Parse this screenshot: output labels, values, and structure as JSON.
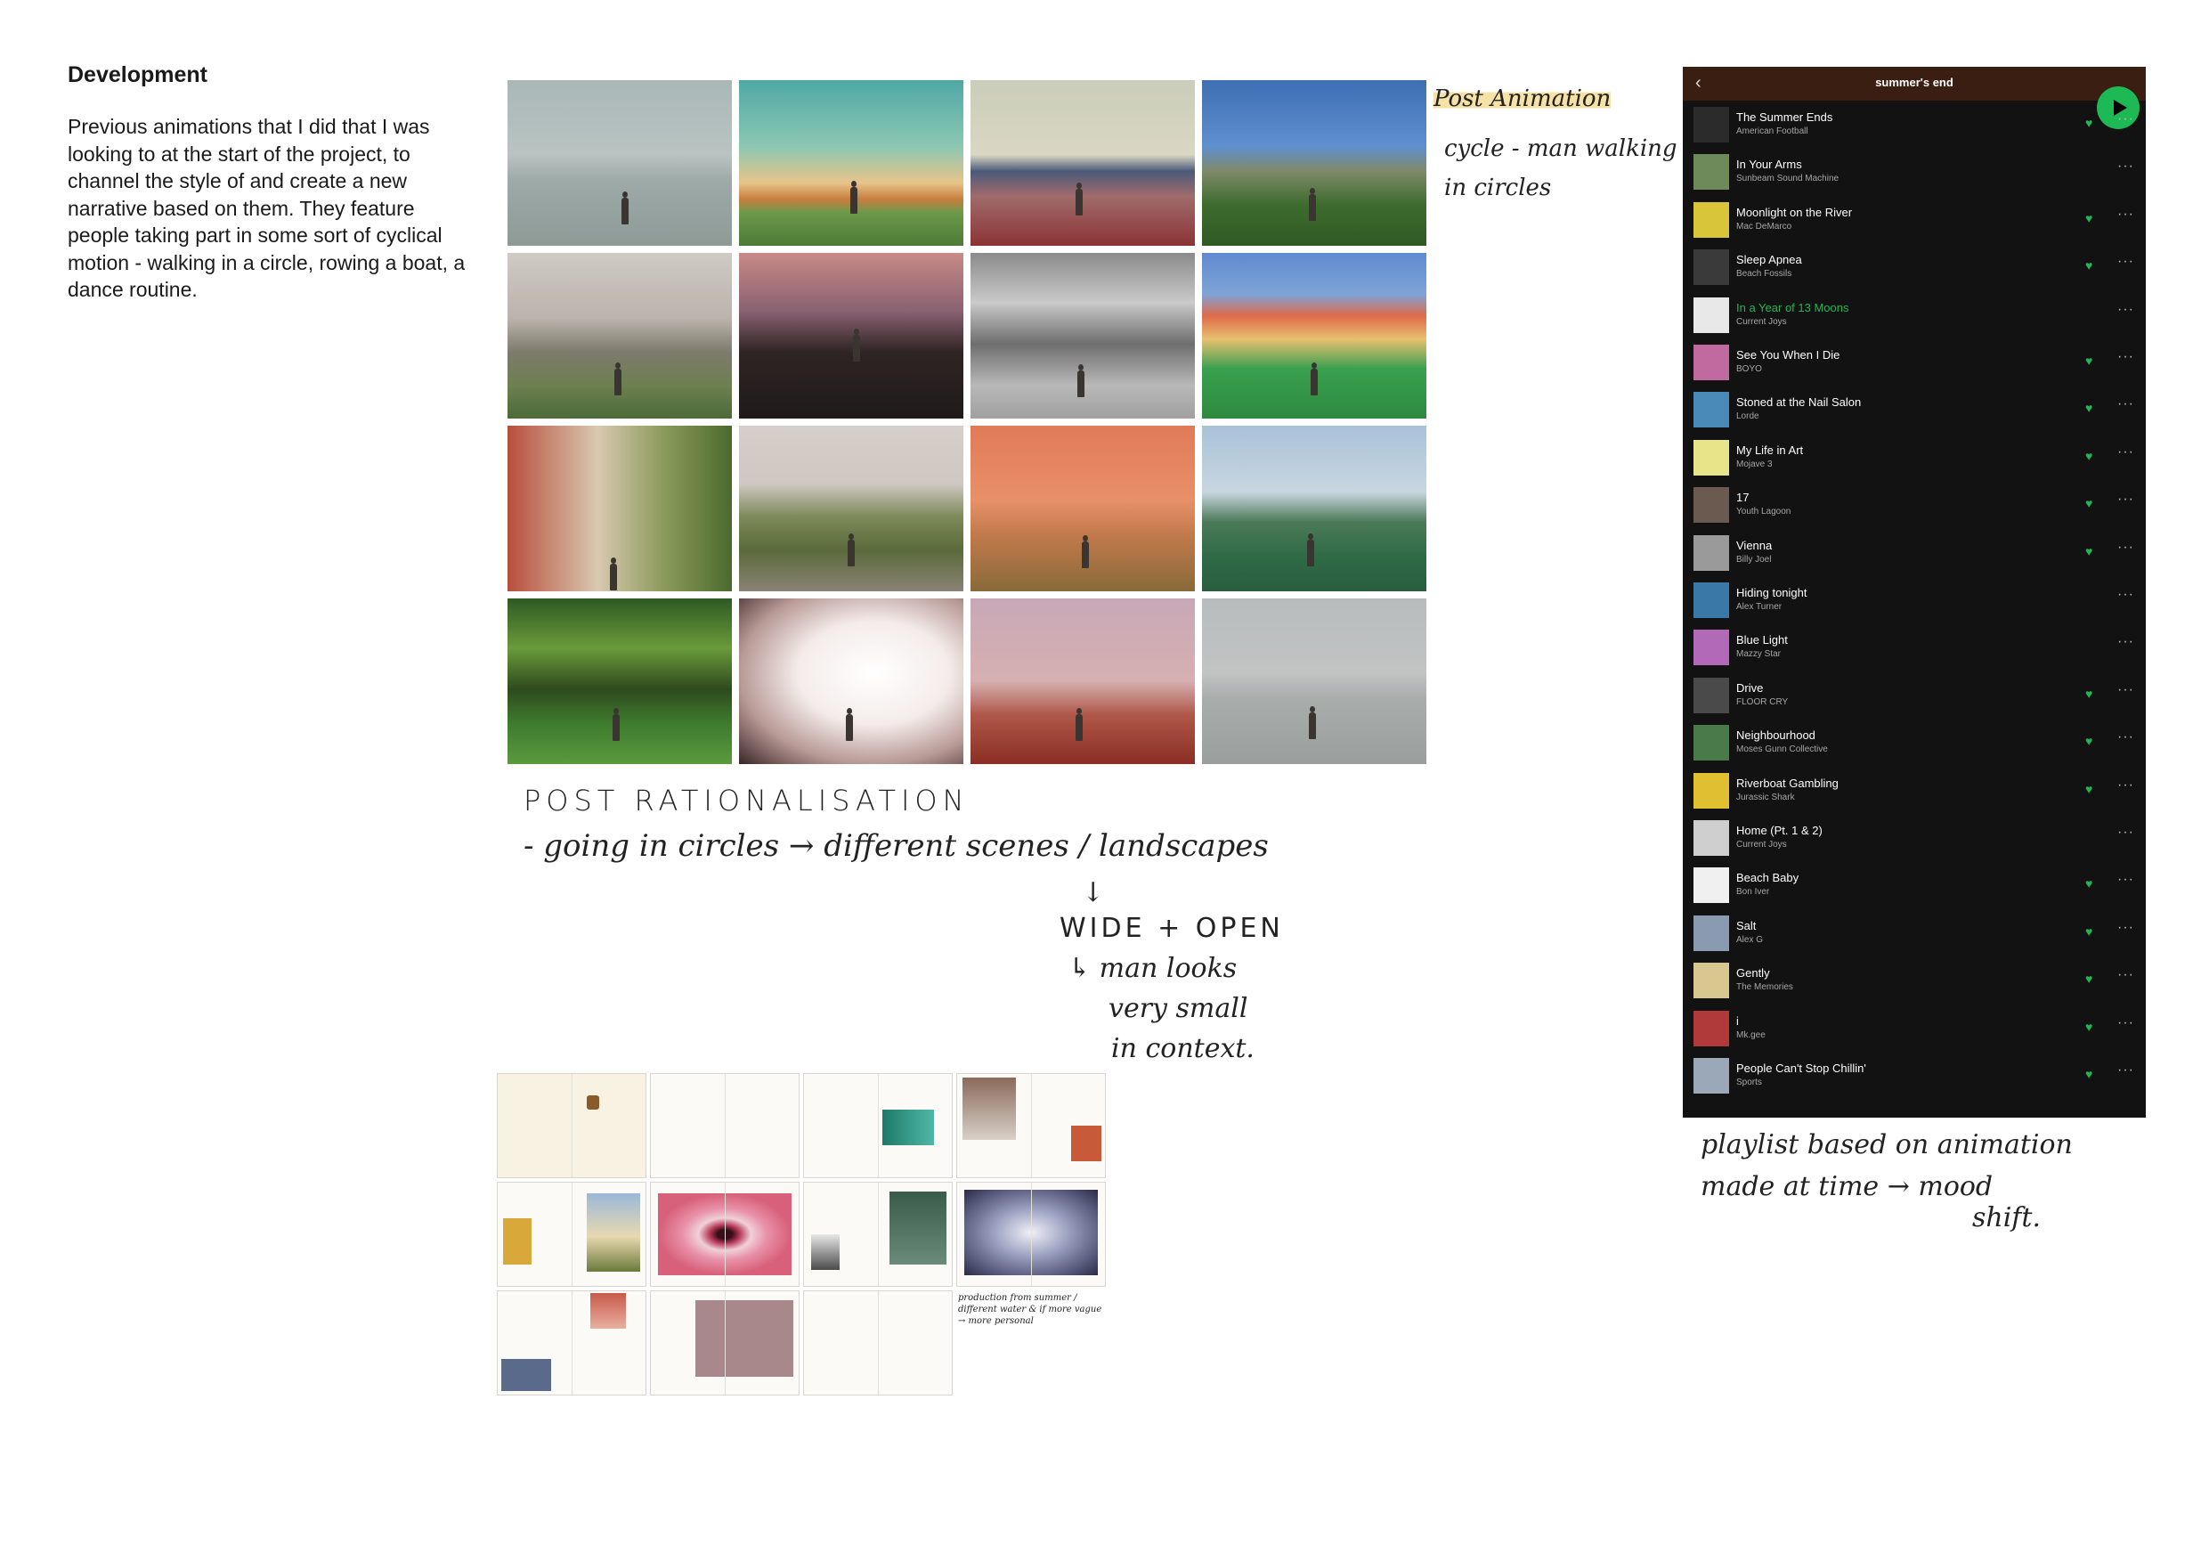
{
  "development": {
    "title": "Development",
    "body": "Previous animations that I did that I was looking to at the start of the project, to channel the style of and create a new narrative based on them. They feature people taking part in some sort of cyclical motion - walking in a circle, rowing a boat, a dance routine."
  },
  "notes": {
    "post_animation": "Post Animation",
    "cycle_1": "cycle - man walking",
    "cycle_2": "in circles",
    "post_rationalisation": "POST RATIONALISATION",
    "going_circles": "- going in circles → different scenes / landscapes",
    "arrow": "↓",
    "wide_open": "WIDE + OPEN",
    "man_looks": "↳ man looks",
    "very_small": "very small",
    "in_context": "in context.",
    "playlist_1": "playlist based on animation",
    "playlist_2": "made at time → mood",
    "playlist_3": "shift.",
    "page_note": "production from summer / different water & if more vague → more personal"
  },
  "playlist": {
    "title": "summer's end",
    "tracks": [
      {
        "title": "The Summer Ends",
        "artist": "American Football",
        "liked": true,
        "color": "#2b2b2b"
      },
      {
        "title": "In Your Arms",
        "artist": "Sunbeam Sound Machine",
        "liked": false,
        "color": "#6f8a5a"
      },
      {
        "title": "Moonlight on the River",
        "artist": "Mac DeMarco",
        "liked": true,
        "color": "#d8c53a"
      },
      {
        "title": "Sleep Apnea",
        "artist": "Beach Fossils",
        "liked": true,
        "color": "#3a3a3a"
      },
      {
        "title": "In a Year of 13 Moons",
        "artist": "Current Joys",
        "liked": false,
        "playing": true,
        "color": "#e8e8e8"
      },
      {
        "title": "See You When I Die",
        "artist": "BOYO",
        "liked": true,
        "color": "#c06aa0"
      },
      {
        "title": "Stoned at the Nail Salon",
        "artist": "Lorde",
        "liked": true,
        "color": "#4a8ab8"
      },
      {
        "title": "My Life in Art",
        "artist": "Mojave 3",
        "liked": true,
        "color": "#e8e48a"
      },
      {
        "title": "17",
        "artist": "Youth Lagoon",
        "liked": true,
        "color": "#6a5a50"
      },
      {
        "title": "Vienna",
        "artist": "Billy Joel",
        "liked": true,
        "color": "#9a9a9a"
      },
      {
        "title": "Hiding tonight",
        "artist": "Alex Turner",
        "liked": false,
        "color": "#3a78a8"
      },
      {
        "title": "Blue Light",
        "artist": "Mazzy Star",
        "liked": false,
        "color": "#b26ab8"
      },
      {
        "title": "Drive",
        "artist": "FLOOR CRY",
        "liked": true,
        "color": "#4a4a4a"
      },
      {
        "title": "Neighbourhood",
        "artist": "Moses Gunn Collective",
        "liked": true,
        "color": "#4a7a4a"
      },
      {
        "title": "Riverboat Gambling",
        "artist": "Jurassic Shark",
        "liked": true,
        "color": "#e0c030"
      },
      {
        "title": "Home (Pt. 1 & 2)",
        "artist": "Current Joys",
        "liked": false,
        "color": "#cfcfcf"
      },
      {
        "title": "Beach Baby",
        "artist": "Bon Iver",
        "liked": true,
        "color": "#f0f0f0"
      },
      {
        "title": "Salt",
        "artist": "Alex G",
        "liked": true,
        "color": "#8a9ab0"
      },
      {
        "title": "Gently",
        "artist": "The Memories",
        "liked": true,
        "color": "#d8c890"
      },
      {
        "title": "i",
        "artist": "Mk.gee",
        "liked": true,
        "color": "#b03a3a"
      },
      {
        "title": "People Can't Stop Chillin'",
        "artist": "Sports",
        "liked": true,
        "color": "#9aa8b8"
      }
    ]
  },
  "colors": {
    "spotify_green": "#1db954",
    "panel_bg": "#121212",
    "header_bg": "#3a1e12",
    "highlight": "#f6e1a6"
  },
  "tiles": [
    {
      "name": "photo-sea-pier",
      "bg": "linear-gradient(#a9b7b6 0%, #b9c4c2 45%, #9eaaa8 60%, #8e9a96 100%)"
    },
    {
      "name": "photo-teal-sky-buildings",
      "bg": "linear-gradient(#4fa8a6 0%, #8cc7b2 40%, #e7c48a 62%, #c77d3c 72%, #6c9a4a 80%, #4d7a36 100%)"
    },
    {
      "name": "photo-mountain-lake",
      "bg": "linear-gradient(#c9cdb9 0%, #dad7c3 45%, #4b5a7a 55%, #a06b6b 70%, #8c3434 100%)"
    },
    {
      "name": "photo-house-dusk",
      "bg": "linear-gradient(#3e6fb4 0%, #5f8fcf 40%, #7f8a6a 55%, #3e6c2e 75%, #2f5a24 100%)"
    },
    {
      "name": "photo-foggy-park",
      "bg": "linear-gradient(#cfcac4 0%, #b9b3ab 40%, #7d7a6c 60%, #6d8050 80%, #4c6a38 100%)"
    },
    {
      "name": "photo-street-night",
      "bg": "linear-gradient(#c88a86 0%, #8a6272 35%, #2f2424 60%, #1f1a1a 100%)"
    },
    {
      "name": "photo-monochrome-building",
      "bg": "linear-gradient(#8a8a8a 0%, #c9c9c9 30%, #6e6e6e 55%, #b8b8b8 80%, #a0a0a0 100%)"
    },
    {
      "name": "photo-colourful-houses",
      "bg": "linear-gradient(#5f8ad0 0%, #7ea3d6 25%, #e06a4a 38%, #e8c070 52%, #3aa050 70%, #2e8a3e 100%)"
    },
    {
      "name": "photo-church-street",
      "bg": "linear-gradient(90deg, #b84e3c 0%, #d9c8b0 40%, #8a9a5a 70%, #4c6a2e 100%)"
    },
    {
      "name": "photo-rolling-hills",
      "bg": "linear-gradient(#d6cfc9 0%, #cfc8c2 35%, #7e8a5a 55%, #5a6a3a 75%, #8a8275 100%)"
    },
    {
      "name": "photo-orange-sky-field",
      "bg": "linear-gradient(#e07a58 0%, #e8906a 45%, #c37a4c 65%, #8a6a3a 100%)"
    },
    {
      "name": "photo-green-field-trees",
      "bg": "linear-gradient(#a9c2d8 0%, #c8d6e0 40%, #4c7a58 58%, #2e6a46 80%, #2a5e3e 100%)"
    },
    {
      "name": "photo-hedge-lawn",
      "bg": "linear-gradient(#2e5a24 0%, #6a9a3a 30%, #2e4a1e 55%, #3e7a2e 75%, #5a9a3e 100%)"
    },
    {
      "name": "photo-vignette-white",
      "bg": "radial-gradient(ellipse at 60% 45%, #ffffff 0%, #f4ecea 40%, #b89a96 70%, #3a2426 100%)"
    },
    {
      "name": "photo-red-field-dusk",
      "bg": "linear-gradient(#c8a8b8 0%, #d6b0b0 50%, #b0584a 70%, #8a2e24 100%)"
    },
    {
      "name": "photo-grey-sea-pier",
      "bg": "linear-gradient(#b8bcbc 0%, #c2c4c4 45%, #a9adac 60%, #9a9e9c 100%)"
    }
  ]
}
